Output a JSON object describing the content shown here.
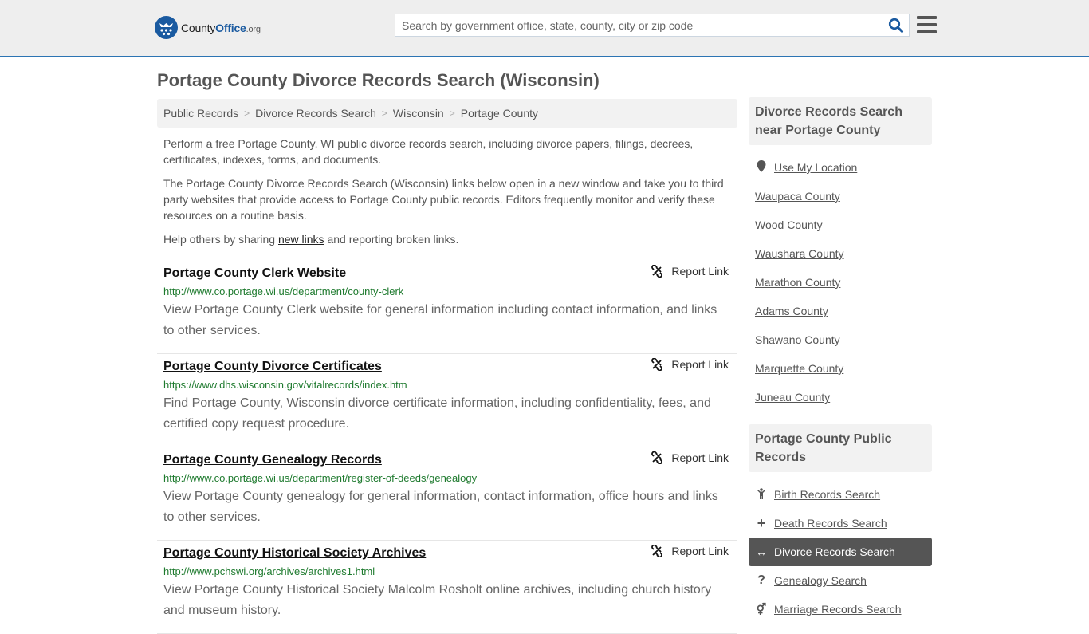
{
  "header": {
    "logo": {
      "county": "County",
      "office": "Office",
      "org": ".org"
    },
    "search_placeholder": "Search by government office, state, county, city or zip code",
    "search_value": "",
    "accent_color": "#2c74b3"
  },
  "page_title": "Portage County Divorce Records Search (Wisconsin)",
  "breadcrumb": [
    {
      "label": "Public Records"
    },
    {
      "label": "Divorce Records Search"
    },
    {
      "label": "Wisconsin"
    },
    {
      "label": "Portage County"
    }
  ],
  "intro": {
    "p1": "Perform a free Portage County, WI public divorce records search, including divorce papers, filings, decrees, certificates, indexes, forms, and documents.",
    "p2": "The Portage County Divorce Records Search (Wisconsin) links below open in a new window and take you to third party websites that provide access to Portage County public records. Editors frequently monitor and verify these resources on a routine basis.",
    "p3_before": "Help others by sharing ",
    "p3_link": "new links",
    "p3_after": " and reporting broken links."
  },
  "report_label": "Report Link",
  "results": [
    {
      "title": "Portage County Clerk Website",
      "url": "http://www.co.portage.wi.us/department/county-clerk",
      "description": "View Portage County Clerk website for general information including contact information, and links to other services."
    },
    {
      "title": "Portage County Divorce Certificates",
      "url": "https://www.dhs.wisconsin.gov/vitalrecords/index.htm",
      "description": "Find Portage County, Wisconsin divorce certificate information, including confidentiality, fees, and certified copy request procedure."
    },
    {
      "title": "Portage County Genealogy Records",
      "url": "http://www.co.portage.wi.us/department/register-of-deeds/genealogy",
      "description": "View Portage County genealogy for general information, contact information, office hours and links to other services."
    },
    {
      "title": "Portage County Historical Society Archives",
      "url": "http://www.pchswi.org/archives/archives1.html",
      "description": "View Portage County Historical Society Malcolm Rosholt online archives, including church history and museum history."
    }
  ],
  "sidebar": {
    "nearby_title": "Divorce Records Search near Portage County",
    "use_location": "Use My Location",
    "nearby": [
      "Waupaca County",
      "Wood County",
      "Waushara County",
      "Marathon County",
      "Adams County",
      "Shawano County",
      "Marquette County",
      "Juneau County"
    ],
    "public_title": "Portage County Public Records",
    "public_records": [
      {
        "label": "Birth Records Search",
        "icon": "child-icon",
        "glyph": "Ὣ8",
        "active": false
      },
      {
        "label": "Death Records Search",
        "icon": "plus-icon",
        "glyph": "+",
        "active": false
      },
      {
        "label": "Divorce Records Search",
        "icon": "arrows-horizontal-icon",
        "glyph": "↔",
        "active": true
      },
      {
        "label": "Genealogy Search",
        "icon": "question-icon",
        "glyph": "?",
        "active": false
      },
      {
        "label": "Marriage Records Search",
        "icon": "venus-mars-icon",
        "glyph": "⚥",
        "active": false
      }
    ]
  }
}
